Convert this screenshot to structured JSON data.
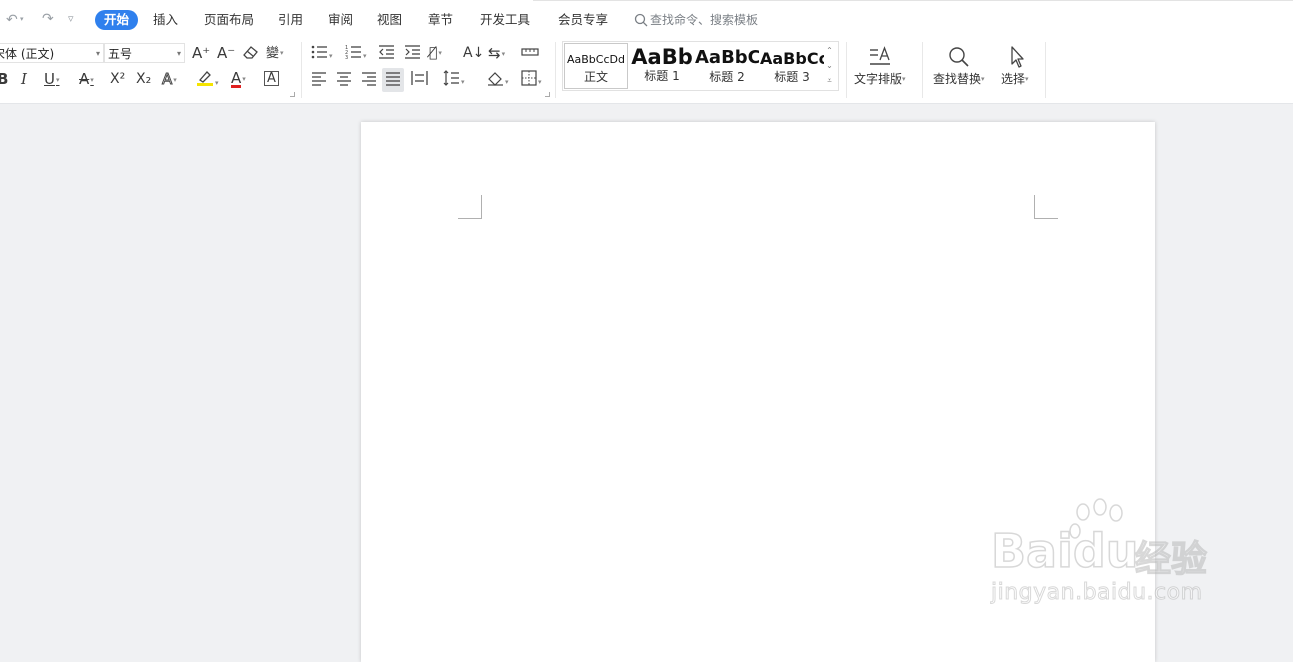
{
  "quick_access": {
    "undo": "↶",
    "redo": "↷",
    "customize": "▿"
  },
  "tabs": [
    {
      "label": "开始",
      "active": true
    },
    {
      "label": "插入"
    },
    {
      "label": "页面布局"
    },
    {
      "label": "引用"
    },
    {
      "label": "审阅"
    },
    {
      "label": "视图"
    },
    {
      "label": "章节"
    },
    {
      "label": "开发工具"
    },
    {
      "label": "会员专享"
    }
  ],
  "search": {
    "placeholder": "查找命令、搜索模板"
  },
  "font": {
    "name": "宋体 (正文)",
    "size": "五号"
  },
  "font_buttons": {
    "grow": "A⁺",
    "shrink": "A⁻",
    "bold": "B",
    "italic": "I",
    "underline": "U",
    "strike": "A",
    "superscript": "X²",
    "subscript": "X₂",
    "text_effect": "A",
    "highlight": "A",
    "font_color": "A",
    "char_border": "A",
    "pinyin": "wén"
  },
  "styles": [
    {
      "preview": "AaBbCcDd",
      "name": "正文"
    },
    {
      "preview": "AaBb",
      "name": "标题 1"
    },
    {
      "preview": "AaBbC",
      "name": "标题 2"
    },
    {
      "preview": "AaBbCc",
      "name": "标题 3"
    }
  ],
  "big_buttons": {
    "text_layout": "文字排版",
    "find_replace": "查找替换",
    "select": "选择"
  },
  "watermark": {
    "logo": "Baidu",
    "cn": "经验",
    "url": "jingyan.baidu.com"
  },
  "colors": {
    "accent": "#2f80ed",
    "highlight": "#f5e400",
    "font_color": "#e02020"
  }
}
